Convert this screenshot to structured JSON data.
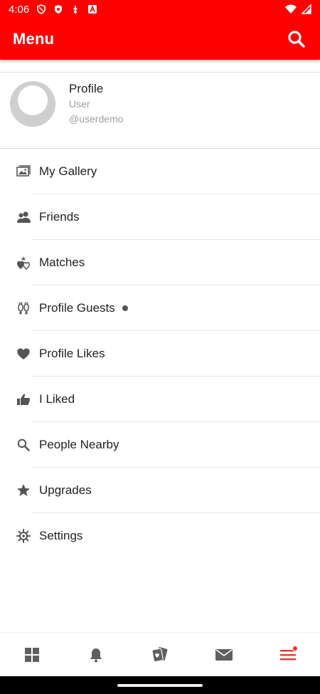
{
  "status_bar": {
    "time": "4:06",
    "left_icons": [
      "shield-icon",
      "shield-badge-icon",
      "download-icon",
      "app-icon"
    ],
    "right_icons": [
      "wifi-icon",
      "signal-icon"
    ]
  },
  "app_bar": {
    "title": "Menu",
    "search_icon": "search-icon",
    "color": "#ff0000"
  },
  "profile": {
    "name": "Profile",
    "role": "User",
    "handle": "@userdemo"
  },
  "menu": {
    "items": [
      {
        "label": "My Gallery",
        "icon": "gallery-icon"
      },
      {
        "label": "Friends",
        "icon": "friends-icon"
      },
      {
        "label": "Matches",
        "icon": "matches-icon"
      },
      {
        "label": "Profile Guests",
        "icon": "footprints-icon",
        "badge": true
      },
      {
        "label": "Profile Likes",
        "icon": "heart-icon"
      },
      {
        "label": "I Liked",
        "icon": "thumbs-up-icon"
      },
      {
        "label": "People Nearby",
        "icon": "search-icon"
      },
      {
        "label": "Upgrades",
        "icon": "star-icon"
      },
      {
        "label": "Settings",
        "icon": "gear-icon"
      }
    ]
  },
  "bottom_nav": {
    "items": [
      {
        "icon": "grid-icon"
      },
      {
        "icon": "bell-icon"
      },
      {
        "icon": "cards-icon"
      },
      {
        "icon": "mail-icon"
      },
      {
        "icon": "hamburger-menu-icon",
        "active": true,
        "badge": true
      }
    ],
    "active_color": "#e53935",
    "inactive_color": "#5f5f5f"
  }
}
